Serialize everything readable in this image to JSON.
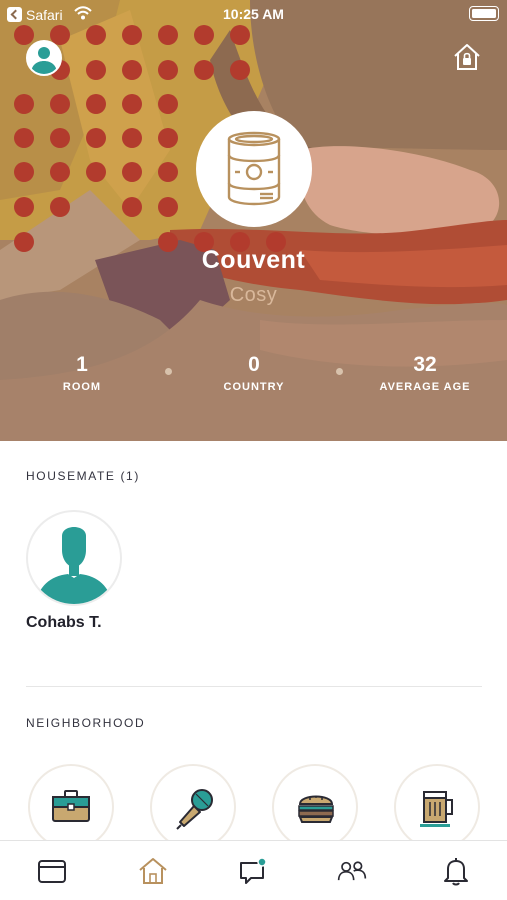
{
  "status_bar": {
    "carrier": "Safari",
    "time": "10:25 AM"
  },
  "header": {
    "avatar_icon": "user-avatar-icon",
    "right_icon": "home-lock-icon"
  },
  "house": {
    "icon": "tin-can-icon",
    "name": "Couvent",
    "type": "Cosy"
  },
  "stats": [
    {
      "value": "1",
      "label": "ROOM"
    },
    {
      "value": "0",
      "label": "COUNTRY"
    },
    {
      "value": "32",
      "label": "AVERAGE AGE"
    }
  ],
  "housemates": {
    "title": "HOUSEMATE (1)",
    "items": [
      {
        "name": "Cohabs T.",
        "icon": "user-silhouette-icon"
      }
    ]
  },
  "neighborhood": {
    "title": "NEIGHBORHOOD",
    "items": [
      {
        "icon": "briefcase-icon"
      },
      {
        "icon": "microphone-icon"
      },
      {
        "icon": "burger-icon"
      },
      {
        "icon": "beer-mug-icon"
      }
    ]
  },
  "tab_bar": {
    "tabs": [
      {
        "icon": "card-icon",
        "active": false
      },
      {
        "icon": "home-icon",
        "active": true
      },
      {
        "icon": "chat-icon",
        "active": false
      },
      {
        "icon": "people-icon",
        "active": false
      },
      {
        "icon": "bell-icon",
        "active": false
      }
    ]
  },
  "colors": {
    "accent_teal": "#2a9d96",
    "gold": "#b8915e",
    "hero_brown": "#a27d5d",
    "dots_red": "#b23b2d"
  }
}
